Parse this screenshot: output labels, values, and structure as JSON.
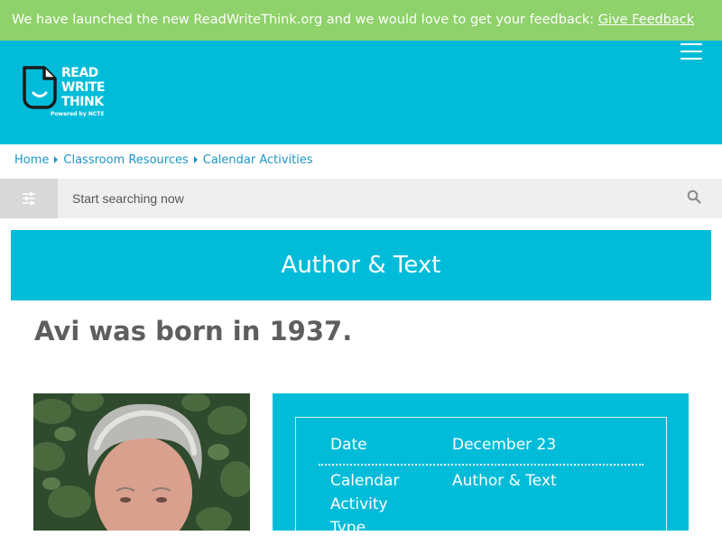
{
  "banner": {
    "message": "We have launched the new ReadWriteThink.org and we would love to get your feedback: ",
    "link_label": "Give Feedback",
    "color": "#8fd16a"
  },
  "header": {
    "color": "#00bcd9",
    "logo": {
      "line1": "READ",
      "line2": "WRITE",
      "line3": "THINK",
      "tagline": "Powered by NCTE"
    },
    "menu_icon": "hamburger-menu-icon"
  },
  "breadcrumb": {
    "items": [
      "Home",
      "Classroom Resources",
      "Calendar Activities"
    ]
  },
  "search": {
    "placeholder": "Start searching now",
    "filter_icon": "sliders-icon",
    "search_icon": "search-icon"
  },
  "section": {
    "title": "Author & Text"
  },
  "headline": "Avi was born in 1937.",
  "details": {
    "rows": [
      {
        "label": "Date",
        "value": "December 23"
      },
      {
        "label": "Calendar Activity Type",
        "value": "Author & Text"
      }
    ]
  },
  "colors": {
    "accent": "#00bcd9",
    "link": "#1b96c5",
    "headline": "#5e5e5e"
  }
}
